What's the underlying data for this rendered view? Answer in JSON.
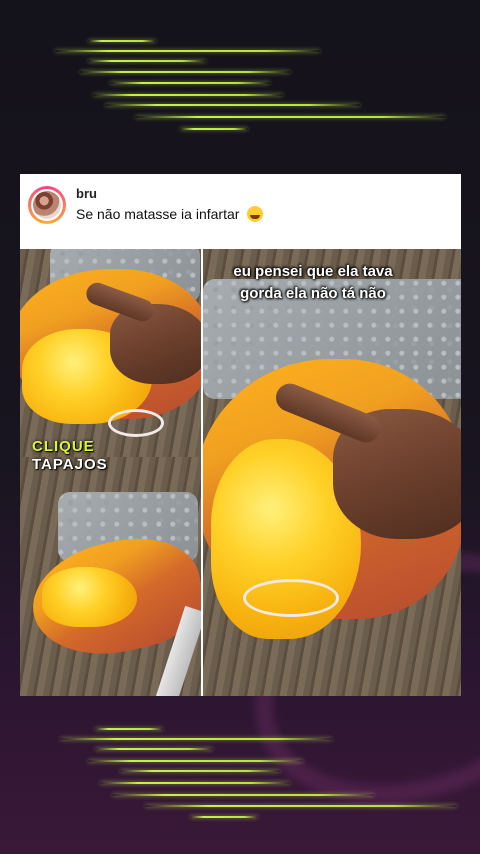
{
  "post": {
    "username": "bru",
    "caption": "Se não matasse ia infartar",
    "caption_emoji_icon": "laughing-crying-emoji"
  },
  "photos": {
    "overlay_line1": "eu pensei que ela tava",
    "overlay_line2": "gorda ela não tá não",
    "watermark_line1": "CLIQUE",
    "watermark_line2": "TAPAJOS"
  },
  "colors": {
    "accent_lines": "#c8f04a",
    "background": "#14121a"
  }
}
